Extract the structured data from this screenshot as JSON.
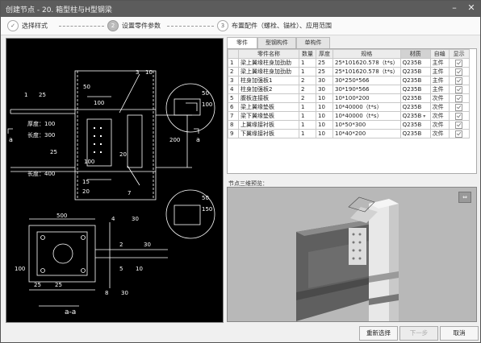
{
  "window": {
    "title": "创建节点 - 20. 箱型柱与H型钢梁",
    "minimize_label": "–",
    "close_label": "✕"
  },
  "steps": [
    {
      "num": "✓",
      "label": "选择样式"
    },
    {
      "num": "2",
      "label": "设置零件参数"
    },
    {
      "num": "3",
      "label": "布置配件（螺栓、锚栓）、应用范围"
    }
  ],
  "tabs": [
    {
      "label": "零件"
    },
    {
      "label": "型钢构件"
    },
    {
      "label": "单构件"
    }
  ],
  "table": {
    "headers": [
      "",
      "零件名称",
      "数量",
      "厚度",
      "规格",
      "材质",
      "自编",
      "显示"
    ],
    "rows": [
      {
        "no": "1",
        "name": "梁上翼缘柱身加劲肋",
        "qty": "1",
        "thk": "25",
        "spec": "25*101620.578（t*s）",
        "mat": "Q235B",
        "type": "主件"
      },
      {
        "no": "2",
        "name": "梁上翼缘柱身加劲肋",
        "qty": "1",
        "thk": "25",
        "spec": "25*101620.578（t*s）",
        "mat": "Q235B",
        "type": "主件"
      },
      {
        "no": "3",
        "name": "柱身加强板1",
        "qty": "2",
        "thk": "30",
        "spec": "30*250*566",
        "mat": "Q235B",
        "type": "主件"
      },
      {
        "no": "4",
        "name": "柱身加强板2",
        "qty": "2",
        "thk": "30",
        "spec": "30*190*566",
        "mat": "Q235B",
        "type": "主件"
      },
      {
        "no": "5",
        "name": "腹板连接板",
        "qty": "2",
        "thk": "10",
        "spec": "10*100*200",
        "mat": "Q235B",
        "type": "次件"
      },
      {
        "no": "6",
        "name": "梁上翼缘垫板",
        "qty": "1",
        "thk": "10",
        "spec": "10*40000（t*s）",
        "mat": "Q235B",
        "type": "次件"
      },
      {
        "no": "7",
        "name": "梁下翼缘垫板",
        "qty": "1",
        "thk": "10",
        "spec": "10*40000（t*s）",
        "mat": "Q235B",
        "type": "次件"
      },
      {
        "no": "8",
        "name": "上翼缘接衬板",
        "qty": "1",
        "thk": "10",
        "spec": "10*50*300",
        "mat": "Q235B",
        "type": "次件"
      },
      {
        "no": "9",
        "name": "下翼缘接衬板",
        "qty": "1",
        "thk": "10",
        "spec": "10*40*200",
        "mat": "Q235B",
        "type": "次件"
      }
    ]
  },
  "view3d_label": "节点三维预览：",
  "buttons": {
    "reselect": "重新选择",
    "next": "下一步",
    "cancel": "取消"
  },
  "drawing": {
    "labels": {
      "d50a": "50",
      "d100a": "100",
      "d1": "1",
      "d25a": "25",
      "thk100": "厚度：100",
      "len300": "长度：300",
      "d100b": "100",
      "d20a": "20",
      "d25b": "25",
      "len400": "长度：400",
      "d15": "15",
      "d20b": "20",
      "d200": "200",
      "d3": "3",
      "d10a": "10",
      "a_left": "a",
      "a_right": "a",
      "d50b": "50",
      "d100c": "100",
      "d7": "7",
      "d50c": "50",
      "d150": "150",
      "d500": "500",
      "d4": "4",
      "d30a": "30",
      "d2": "2",
      "d30b": "30",
      "d5": "5",
      "d10b": "10",
      "d100d": "100",
      "d25c": "25",
      "d25d": "25",
      "d8": "8",
      "d30c": "30",
      "section": "a-a"
    }
  }
}
